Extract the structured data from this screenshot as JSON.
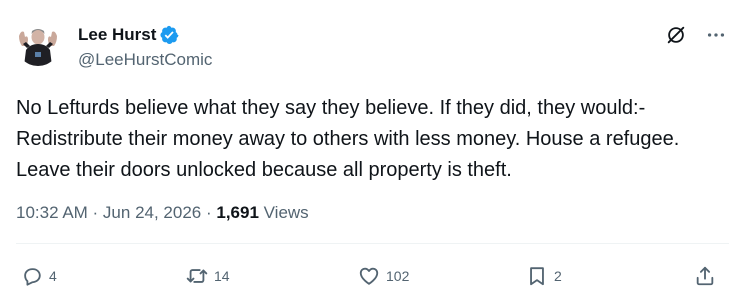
{
  "author": {
    "display_name": "Lee Hurst",
    "handle": "@LeeHurstComic",
    "verified": true
  },
  "post": {
    "text": "No Lefturds believe what they say they believe. If they did, they would:-\nRedistribute their money away to others with less money. House a refugee. Leave their doors unlocked because all property is theft.",
    "timestamp": "10:32 AM · Jun 24, 2026 · ",
    "views_count": "1,691",
    "views_label": " Views"
  },
  "actions": {
    "replies": "4",
    "reposts": "14",
    "likes": "102",
    "bookmarks": "2"
  },
  "colors": {
    "verified_blue": "#1d9bf0",
    "secondary_text": "#536471",
    "primary_text": "#0f1419"
  },
  "icons": {
    "grok": "grok-icon",
    "more": "more-icon",
    "reply": "reply-icon",
    "repost": "repost-icon",
    "like": "heart-icon",
    "bookmark": "bookmark-icon",
    "share": "share-icon"
  }
}
